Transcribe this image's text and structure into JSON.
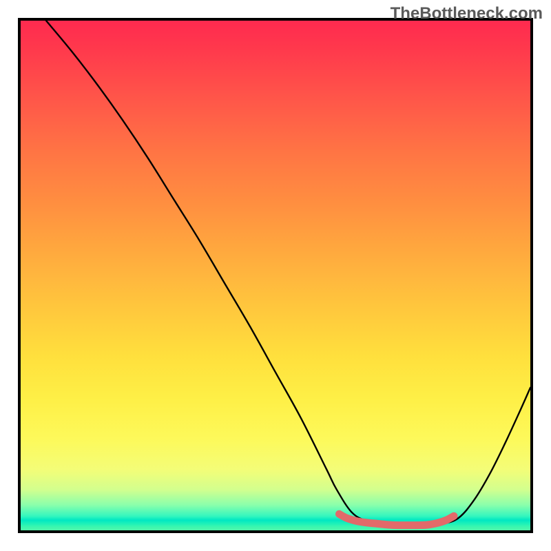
{
  "watermark": "TheBottleneck.com",
  "chart_data": {
    "type": "line",
    "title": "",
    "xlabel": "",
    "ylabel": "",
    "xlim": [
      0,
      100
    ],
    "ylim": [
      0,
      100
    ],
    "series": [
      {
        "name": "main-curve",
        "color": "#000000",
        "x": [
          5,
          10,
          15,
          20,
          25,
          30,
          35,
          40,
          45,
          50,
          55,
          60,
          62,
          65,
          68,
          71,
          74,
          77,
          80,
          83,
          86,
          89,
          92,
          95,
          98,
          100
        ],
        "y": [
          100,
          94,
          87.5,
          80.5,
          73,
          65,
          57,
          48.5,
          40,
          31,
          22,
          12,
          8,
          3.5,
          1.8,
          1.2,
          1.0,
          1.0,
          1.0,
          1.3,
          2.5,
          6,
          11,
          17,
          23.5,
          28
        ]
      },
      {
        "name": "highlight-band",
        "color": "#e26a6a",
        "x": [
          62.5,
          64,
          66,
          68,
          70,
          72,
          74,
          76,
          78,
          80,
          82,
          83.5,
          85
        ],
        "y": [
          3.2,
          2.4,
          1.8,
          1.5,
          1.3,
          1.1,
          1.0,
          1.0,
          1.0,
          1.1,
          1.5,
          2.0,
          2.8
        ]
      }
    ]
  }
}
